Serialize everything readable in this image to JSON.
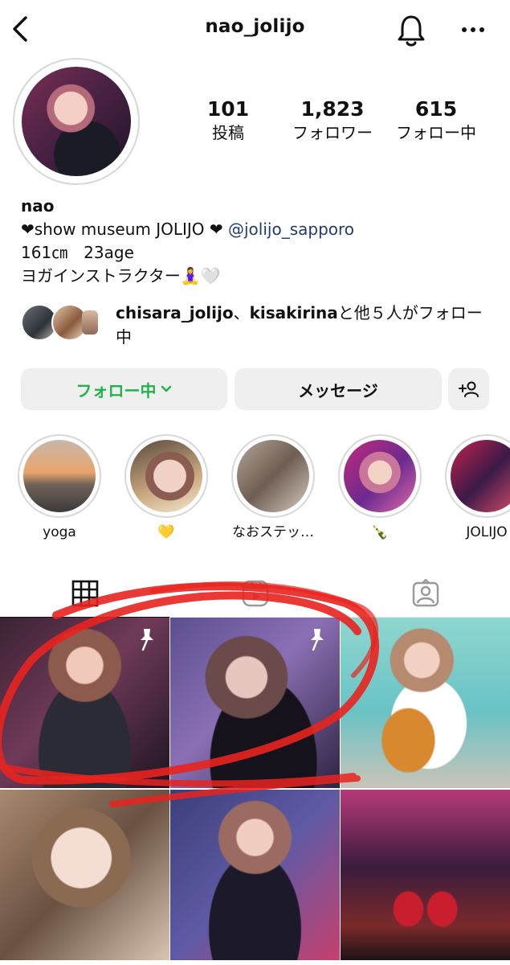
{
  "header": {
    "username": "nao_jolijo",
    "back_icon": "chevron-left-icon",
    "notification_icon": "bell-icon",
    "more_icon": "more-horizontal-icon"
  },
  "stats": [
    {
      "value": "101",
      "label": "投稿"
    },
    {
      "value": "1,823",
      "label": "フォロワー"
    },
    {
      "value": "615",
      "label": "フォロー中"
    }
  ],
  "bio": {
    "name": "nao",
    "line1_prefix": "❤︎show museum JOLIJO ❤︎ ",
    "mention": "@jolijo_sapporo",
    "line2": "161㎝　23age",
    "line3": "ヨガインストラクター🧘‍♀️🤍"
  },
  "followed_by": {
    "user1": "chisara_jolijo",
    "separator": "、",
    "user2": "kisakirina",
    "suffix": "と他５人がフォロー中"
  },
  "buttons": {
    "follow_label": "フォロー中",
    "follow_chevron": "⌄",
    "message_label": "メッセージ",
    "add_user_icon": "add-user-icon"
  },
  "highlights": [
    {
      "label": "yoga"
    },
    {
      "label": "💛"
    },
    {
      "label": "なおステッ…"
    },
    {
      "label": "🍾"
    },
    {
      "label": "JOLIJO"
    }
  ],
  "tabs": [
    {
      "icon": "grid-icon",
      "active": true
    },
    {
      "icon": "reels-icon",
      "active": false
    },
    {
      "icon": "tagged-icon",
      "active": false
    }
  ],
  "colors": {
    "following_green": "#22b24c",
    "mention_blue": "#1f3c78",
    "annotation_red": "#e8231f"
  }
}
